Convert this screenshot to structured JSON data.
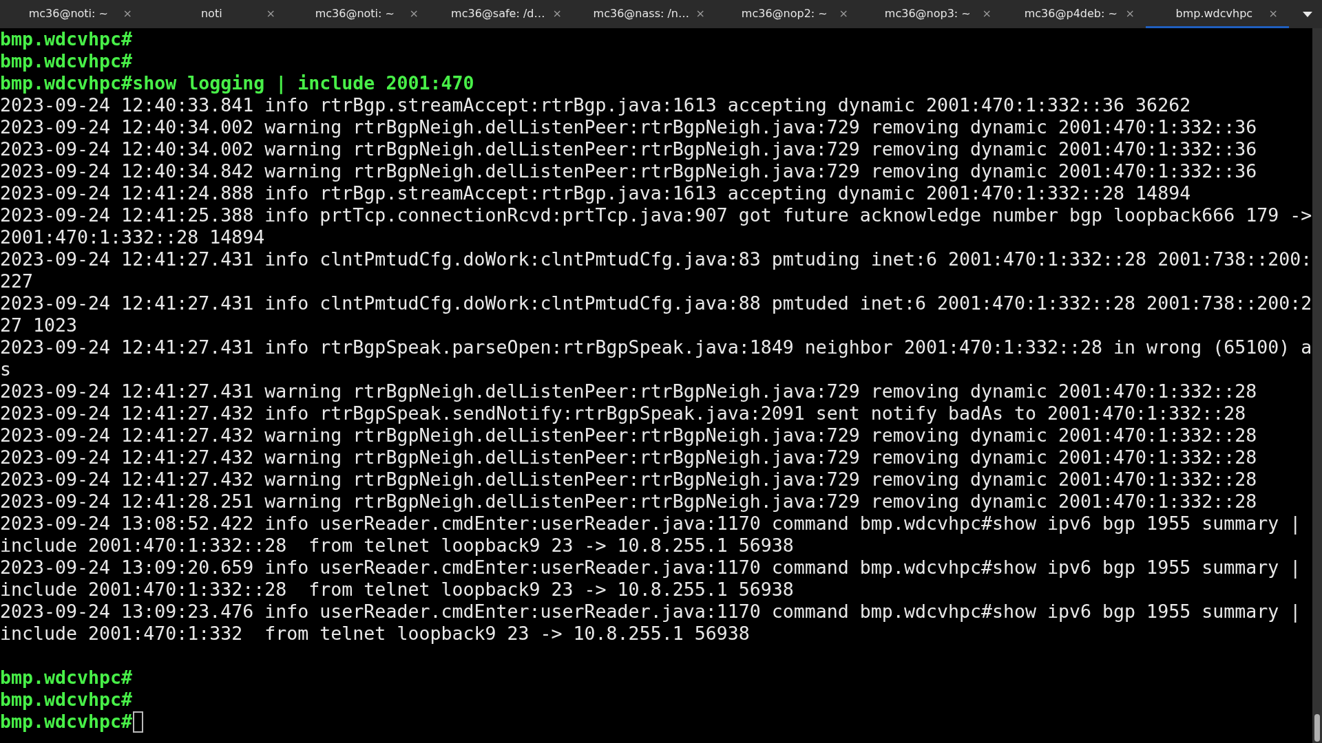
{
  "tabs": [
    {
      "label": "mc36@noti: ~",
      "close": "×",
      "selected": false
    },
    {
      "label": "noti",
      "close": "×",
      "selected": false
    },
    {
      "label": "mc36@noti: ~",
      "close": "×",
      "selected": false
    },
    {
      "label": "mc36@safe: /d…",
      "close": "×",
      "selected": false
    },
    {
      "label": "mc36@nass: /n…",
      "close": "×",
      "selected": false
    },
    {
      "label": "mc36@nop2: ~",
      "close": "×",
      "selected": false
    },
    {
      "label": "mc36@nop3: ~",
      "close": "×",
      "selected": false
    },
    {
      "label": "mc36@p4deb: ~",
      "close": "×",
      "selected": false
    },
    {
      "label": "bmp.wdcvhpc",
      "close": "×",
      "selected": true
    }
  ],
  "terminal": {
    "lines": [
      {
        "kind": "prompt",
        "prompt": "bmp.wdcvhpc#",
        "cursor": false
      },
      {
        "kind": "prompt",
        "prompt": "bmp.wdcvhpc#",
        "cursor": false
      },
      {
        "kind": "prompt",
        "prompt": "bmp.wdcvhpc#",
        "command": "show logging | include 2001:470",
        "cursor": false
      },
      {
        "kind": "output",
        "text": "2023-09-24 12:40:33.841 info rtrBgp.streamAccept:rtrBgp.java:1613 accepting dynamic 2001:470:1:332::36 36262"
      },
      {
        "kind": "output",
        "text": "2023-09-24 12:40:34.002 warning rtrBgpNeigh.delListenPeer:rtrBgpNeigh.java:729 removing dynamic 2001:470:1:332::36"
      },
      {
        "kind": "output",
        "text": "2023-09-24 12:40:34.002 warning rtrBgpNeigh.delListenPeer:rtrBgpNeigh.java:729 removing dynamic 2001:470:1:332::36"
      },
      {
        "kind": "output",
        "text": "2023-09-24 12:40:34.842 warning rtrBgpNeigh.delListenPeer:rtrBgpNeigh.java:729 removing dynamic 2001:470:1:332::36"
      },
      {
        "kind": "output",
        "text": "2023-09-24 12:41:24.888 info rtrBgp.streamAccept:rtrBgp.java:1613 accepting dynamic 2001:470:1:332::28 14894"
      },
      {
        "kind": "output",
        "text": "2023-09-24 12:41:25.388 info prtTcp.connectionRcvd:prtTcp.java:907 got future acknowledge number bgp loopback666 179 -> 2001:470:1:332::28 14894"
      },
      {
        "kind": "output",
        "text": "2023-09-24 12:41:27.431 info clntPmtudCfg.doWork:clntPmtudCfg.java:83 pmtuding inet:6 2001:470:1:332::28 2001:738::200:227"
      },
      {
        "kind": "output",
        "text": "2023-09-24 12:41:27.431 info clntPmtudCfg.doWork:clntPmtudCfg.java:88 pmtuded inet:6 2001:470:1:332::28 2001:738::200:227 1023"
      },
      {
        "kind": "output",
        "text": "2023-09-24 12:41:27.431 info rtrBgpSpeak.parseOpen:rtrBgpSpeak.java:1849 neighbor 2001:470:1:332::28 in wrong (65100) as"
      },
      {
        "kind": "output",
        "text": "2023-09-24 12:41:27.431 warning rtrBgpNeigh.delListenPeer:rtrBgpNeigh.java:729 removing dynamic 2001:470:1:332::28"
      },
      {
        "kind": "output",
        "text": "2023-09-24 12:41:27.432 info rtrBgpSpeak.sendNotify:rtrBgpSpeak.java:2091 sent notify badAs to 2001:470:1:332::28"
      },
      {
        "kind": "output",
        "text": "2023-09-24 12:41:27.432 warning rtrBgpNeigh.delListenPeer:rtrBgpNeigh.java:729 removing dynamic 2001:470:1:332::28"
      },
      {
        "kind": "output",
        "text": "2023-09-24 12:41:27.432 warning rtrBgpNeigh.delListenPeer:rtrBgpNeigh.java:729 removing dynamic 2001:470:1:332::28"
      },
      {
        "kind": "output",
        "text": "2023-09-24 12:41:27.432 warning rtrBgpNeigh.delListenPeer:rtrBgpNeigh.java:729 removing dynamic 2001:470:1:332::28"
      },
      {
        "kind": "output",
        "text": "2023-09-24 12:41:28.251 warning rtrBgpNeigh.delListenPeer:rtrBgpNeigh.java:729 removing dynamic 2001:470:1:332::28"
      },
      {
        "kind": "output",
        "text": "2023-09-24 13:08:52.422 info userReader.cmdEnter:userReader.java:1170 command bmp.wdcvhpc#show ipv6 bgp 1955 summary | include 2001:470:1:332::28  from telnet loopback9 23 -> 10.8.255.1 56938"
      },
      {
        "kind": "output",
        "text": "2023-09-24 13:09:20.659 info userReader.cmdEnter:userReader.java:1170 command bmp.wdcvhpc#show ipv6 bgp 1955 summary | include 2001:470:1:332::28  from telnet loopback9 23 -> 10.8.255.1 56938"
      },
      {
        "kind": "output",
        "text": "2023-09-24 13:09:23.476 info userReader.cmdEnter:userReader.java:1170 command bmp.wdcvhpc#show ipv6 bgp 1955 summary | include 2001:470:1:332  from telnet loopback9 23 -> 10.8.255.1 56938"
      },
      {
        "kind": "blank"
      },
      {
        "kind": "prompt",
        "prompt": "bmp.wdcvhpc#",
        "cursor": false
      },
      {
        "kind": "prompt",
        "prompt": "bmp.wdcvhpc#",
        "cursor": false
      },
      {
        "kind": "prompt",
        "prompt": "bmp.wdcvhpc#",
        "cursor": true
      }
    ]
  }
}
